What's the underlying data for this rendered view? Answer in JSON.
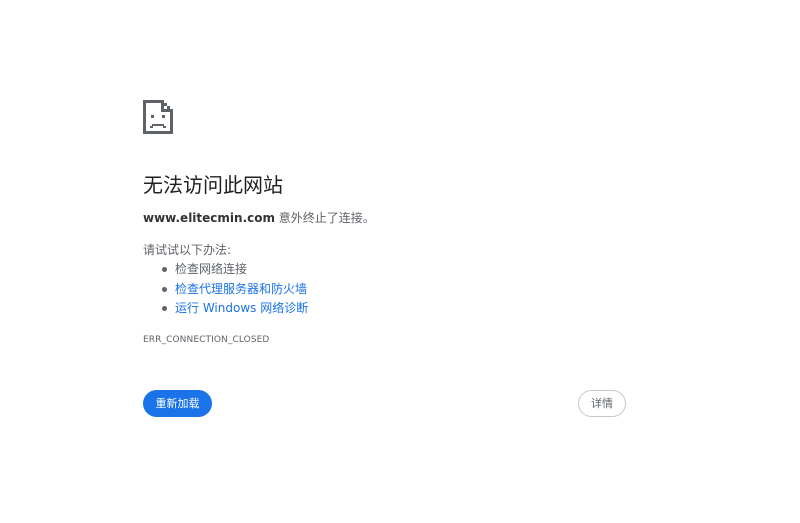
{
  "error_page": {
    "title": "无法访问此网站",
    "host": "www.elitecmin.com",
    "summary_suffix": " 意外终止了连接。",
    "suggestions_heading": "请试试以下办法:",
    "suggestions": [
      {
        "label": "检查网络连接",
        "is_link": false
      },
      {
        "label": "检查代理服务器和防火墙",
        "is_link": true
      },
      {
        "label": "运行 Windows 网络诊断",
        "is_link": true
      }
    ],
    "error_code": "ERR_CONNECTION_CLOSED",
    "reload_label": "重新加载",
    "details_label": "详情",
    "icon": "sad-page-icon",
    "colors": {
      "accent": "#1a73e8",
      "text": "#5f6368",
      "heading": "#202124"
    }
  }
}
